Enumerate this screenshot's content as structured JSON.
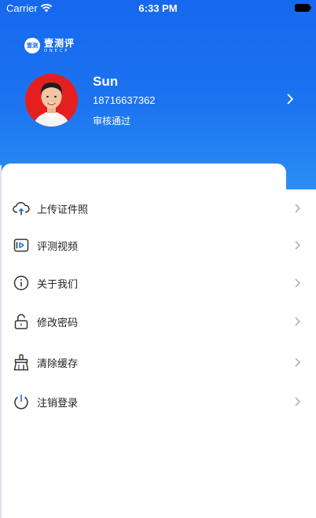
{
  "status_bar": {
    "carrier": "Carrier",
    "time": "6:33 PM"
  },
  "logo": {
    "badge": "壹测",
    "name": "壹测评",
    "subtitle": "ONECP"
  },
  "profile": {
    "name": "Sun",
    "phone": "18716637362",
    "status": "审核通过"
  },
  "menu": [
    {
      "label": "上传证件照",
      "icon": "cloud-upload-icon"
    },
    {
      "label": "评测视频",
      "icon": "video-icon"
    },
    {
      "label": "关于我们",
      "icon": "info-icon"
    },
    {
      "label": "修改密码",
      "icon": "lock-icon"
    },
    {
      "label": "清除缓存",
      "icon": "broom-icon"
    },
    {
      "label": "注销登录",
      "icon": "power-icon"
    }
  ],
  "colors": {
    "primary": "#1a6ff0",
    "avatar_bg": "#e51f20"
  }
}
